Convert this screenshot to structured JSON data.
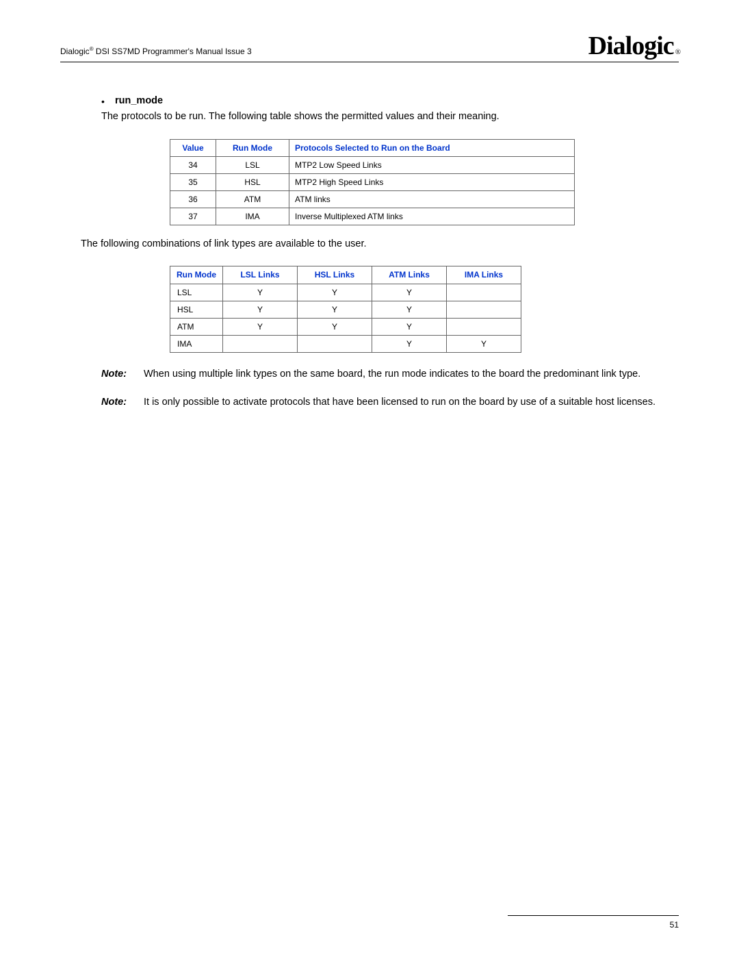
{
  "header": {
    "prefix": "Dialogic",
    "suffix": " DSI SS7MD Programmer's Manual  Issue 3",
    "logo": "Dialogic"
  },
  "section": {
    "bullet_label": "run_mode",
    "intro": "The protocols to be run. The following table shows the permitted values and their meaning."
  },
  "table1": {
    "headers": {
      "value": "Value",
      "mode": "Run Mode",
      "proto": "Protocols Selected to Run on the Board"
    },
    "rows": [
      {
        "value": "34",
        "mode": "LSL",
        "proto": "MTP2 Low Speed Links"
      },
      {
        "value": "35",
        "mode": "HSL",
        "proto": "MTP2 High Speed Links"
      },
      {
        "value": "36",
        "mode": "ATM",
        "proto": "ATM links"
      },
      {
        "value": "37",
        "mode": "IMA",
        "proto": "Inverse Multiplexed ATM links"
      }
    ]
  },
  "mid_para": "The following combinations of link types are available to the user.",
  "table2": {
    "headers": {
      "mode": "Run Mode",
      "lsl": "LSL Links",
      "hsl": "HSL Links",
      "atm": "ATM Links",
      "ima": "IMA Links"
    },
    "rows": [
      {
        "mode": "LSL",
        "lsl": "Y",
        "hsl": "Y",
        "atm": "Y",
        "ima": ""
      },
      {
        "mode": "HSL",
        "lsl": "Y",
        "hsl": "Y",
        "atm": "Y",
        "ima": ""
      },
      {
        "mode": "ATM",
        "lsl": "Y",
        "hsl": "Y",
        "atm": "Y",
        "ima": ""
      },
      {
        "mode": "IMA",
        "lsl": "",
        "hsl": "",
        "atm": "Y",
        "ima": "Y"
      }
    ]
  },
  "notes": {
    "label": "Note:",
    "n1": "When using multiple link types on the same board, the run mode indicates to the board the predominant link type.",
    "n2": "It is only possible to activate protocols that have been licensed to run on the board by use of a suitable host licenses."
  },
  "footer": {
    "page": "51"
  }
}
